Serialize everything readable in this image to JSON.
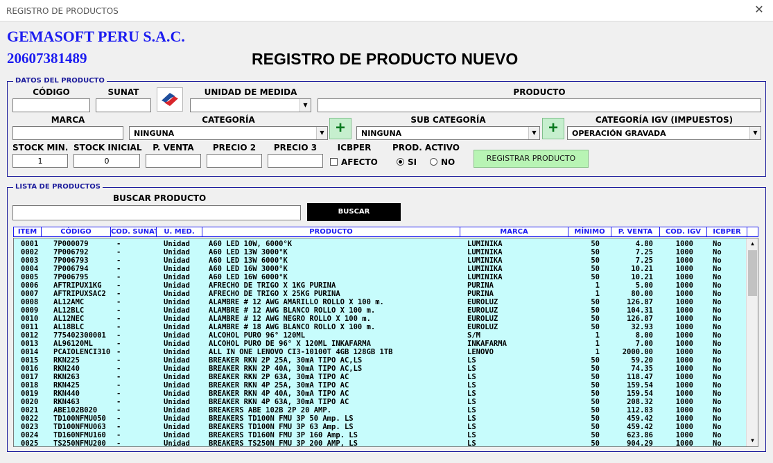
{
  "window": {
    "title": "REGISTRO DE PRODUCTOS",
    "close": "✕"
  },
  "header": {
    "company": "GEMASOFT PERU S.A.C.",
    "ruc": "20607381489",
    "title": "REGISTRO DE PRODUCTO NUEVO"
  },
  "product_form": {
    "legend": "DATOS DEL PRODUCTO",
    "codigo_label": "CÓDIGO",
    "codigo_value": "",
    "sunat_label": "SUNAT",
    "sunat_value": "",
    "unidad_label": "UNIDAD DE MEDIDA",
    "unidad_value": "",
    "producto_label": "PRODUCTO",
    "producto_value": "",
    "marca_label": "MARCA",
    "marca_value": "",
    "categoria_label": "CATEGORÍA",
    "categoria_value": "NINGUNA",
    "subcategoria_label": "SUB CATEGORÍA",
    "subcategoria_value": "NINGUNA",
    "igv_label": "CATEGORÍA IGV  (IMPUESTOS)",
    "igv_value": "OPERACIÓN GRAVADA",
    "stock_min_label": "STOCK MIN.",
    "stock_min_value": "1",
    "stock_ini_label": "STOCK INICIAL",
    "stock_ini_value": "0",
    "pventa_label": "P. VENTA",
    "pventa_value": "",
    "precio2_label": "PRECIO 2",
    "precio2_value": "",
    "precio3_label": "PRECIO 3",
    "precio3_value": "",
    "icbper_label": "ICBPER",
    "afecto_label": "AFECTO",
    "afecto_checked": false,
    "activo_label": "PROD. ACTIVO",
    "si_label": "SI",
    "no_label": "NO",
    "activo_value": "SI",
    "plus": "+",
    "register_button": "REGISTRAR PRODUCTO"
  },
  "product_list": {
    "legend": "LISTA DE PRODUCTOS",
    "search_label": "BUSCAR PRODUCTO",
    "search_value": "",
    "search_button": "BUSCAR",
    "columns": [
      "ITEM",
      "CÓDIGO",
      "COD. SUNAT",
      "U. MED.",
      "PRODUCTO",
      "MARCA",
      "MÍNIMO",
      "P. VENTA",
      "COD. IGV",
      "ICBPER"
    ],
    "rows": [
      [
        "0001",
        "7P000079",
        "-",
        "Unidad",
        "A60 LED 10W, 6000°K",
        "LUMINIKA",
        "50",
        "4.80",
        "1000",
        "No"
      ],
      [
        "0002",
        "7P006792",
        "-",
        "Unidad",
        "A60 LED 13W 3000°K",
        "LUMINIKA",
        "50",
        "7.25",
        "1000",
        "No"
      ],
      [
        "0003",
        "7P006793",
        "-",
        "Unidad",
        "A60 LED 13W 6000°K",
        "LUMINIKA",
        "50",
        "7.25",
        "1000",
        "No"
      ],
      [
        "0004",
        "7P006794",
        "-",
        "Unidad",
        "A60 LED 16W 3000°K",
        "LUMINIKA",
        "50",
        "10.21",
        "1000",
        "No"
      ],
      [
        "0005",
        "7P006795",
        "-",
        "Unidad",
        "A60 LED 16W 6000°K",
        "LUMINIKA",
        "50",
        "10.21",
        "1000",
        "No"
      ],
      [
        "0006",
        "AFTRIPUX1KG",
        "-",
        "Unidad",
        "AFRECHO DE TRIGO X 1KG PURINA",
        "PURINA",
        "1",
        "5.00",
        "1000",
        "No"
      ],
      [
        "0007",
        "AFTRIPUXSAC2",
        "-",
        "Unidad",
        "AFRECHO DE TRIGO X 25KG PURINA",
        "PURINA",
        "1",
        "80.00",
        "1000",
        "No"
      ],
      [
        "0008",
        "AL12AMC",
        "-",
        "Unidad",
        "ALAMBRE # 12 AWG AMARILLO ROLLO X 100 m.",
        "EUROLUZ",
        "50",
        "126.87",
        "1000",
        "No"
      ],
      [
        "0009",
        "AL12BLC",
        "-",
        "Unidad",
        "ALAMBRE # 12 AWG BLANCO ROLLO X 100 m.",
        "EUROLUZ",
        "50",
        "104.31",
        "1000",
        "No"
      ],
      [
        "0010",
        "AL12NEC",
        "-",
        "Unidad",
        "ALAMBRE # 12 AWG NEGRO ROLLO X 100 m.",
        "EUROLUZ",
        "50",
        "126.87",
        "1000",
        "No"
      ],
      [
        "0011",
        "AL18BLC",
        "-",
        "Unidad",
        "ALAMBRE # 18 AWG BLANCO ROLLO X 100 m.",
        "EUROLUZ",
        "50",
        "32.93",
        "1000",
        "No"
      ],
      [
        "0012",
        "775402300001",
        "-",
        "Unidad",
        "ALCOHOL PURO 96° 120ML",
        "S/M",
        "1",
        "8.00",
        "1000",
        "No"
      ],
      [
        "0013",
        "AL96120ML",
        "-",
        "Unidad",
        "ALCOHOL PURO DE 96° X 120ML INKAFARMA",
        "INKAFARMA",
        "1",
        "7.00",
        "1000",
        "No"
      ],
      [
        "0014",
        "PCAIOLENCI310",
        "-",
        "Unidad",
        "ALL IN ONE LENOVO CI3-10100T 4GB 128GB 1TB",
        "LENOVO",
        "1",
        "2000.00",
        "1000",
        "No"
      ],
      [
        "0015",
        "RKN225",
        "-",
        "Unidad",
        "BREAKER RKN 2P 25A, 30mA TIPO AC,LS",
        "LS",
        "50",
        "59.20",
        "1000",
        "No"
      ],
      [
        "0016",
        "RKN240",
        "-",
        "Unidad",
        "BREAKER RKN 2P 40A, 30mA TIPO AC,LS",
        "LS",
        "50",
        "74.35",
        "1000",
        "No"
      ],
      [
        "0017",
        "RKN263",
        "-",
        "Unidad",
        "BREAKER RKN 2P 63A, 30mA TIPO AC",
        "LS",
        "50",
        "118.47",
        "1000",
        "No"
      ],
      [
        "0018",
        "RKN425",
        "-",
        "Unidad",
        "BREAKER RKN 4P 25A, 30mA TIPO AC",
        "LS",
        "50",
        "159.54",
        "1000",
        "No"
      ],
      [
        "0019",
        "RKN440",
        "-",
        "Unidad",
        "BREAKER RKN 4P 40A, 30mA TIPO AC",
        "LS",
        "50",
        "159.54",
        "1000",
        "No"
      ],
      [
        "0020",
        "RKN463",
        "-",
        "Unidad",
        "BREAKER RKN 4P 63A, 30mA TIPO AC",
        "LS",
        "50",
        "208.32",
        "1000",
        "No"
      ],
      [
        "0021",
        "ABE102B020",
        "-",
        "Unidad",
        "BREAKERS ABE 102B 2P 20 AMP.",
        "LS",
        "50",
        "112.83",
        "1000",
        "No"
      ],
      [
        "0022",
        "TD100NFMU050",
        "-",
        "Unidad",
        "BREAKERS TD100N FMU 3P 50 Amp. LS",
        "LS",
        "50",
        "459.42",
        "1000",
        "No"
      ],
      [
        "0023",
        "TD100NFMU063",
        "-",
        "Unidad",
        "BREAKERS TD100N FMU 3P 63 Amp. LS",
        "LS",
        "50",
        "459.42",
        "1000",
        "No"
      ],
      [
        "0024",
        "TD160NFMU160",
        "-",
        "Unidad",
        "BREAKERS TD160N FMU 3P 160 Amp. LS",
        "LS",
        "50",
        "623.86",
        "1000",
        "No"
      ],
      [
        "0025",
        "TS250NFMU200",
        "-",
        "Unidad",
        "BREAKERS TS250N FMU 3P 200 AMP, LS",
        "LS",
        "50",
        "904.29",
        "1000",
        "No"
      ]
    ]
  }
}
